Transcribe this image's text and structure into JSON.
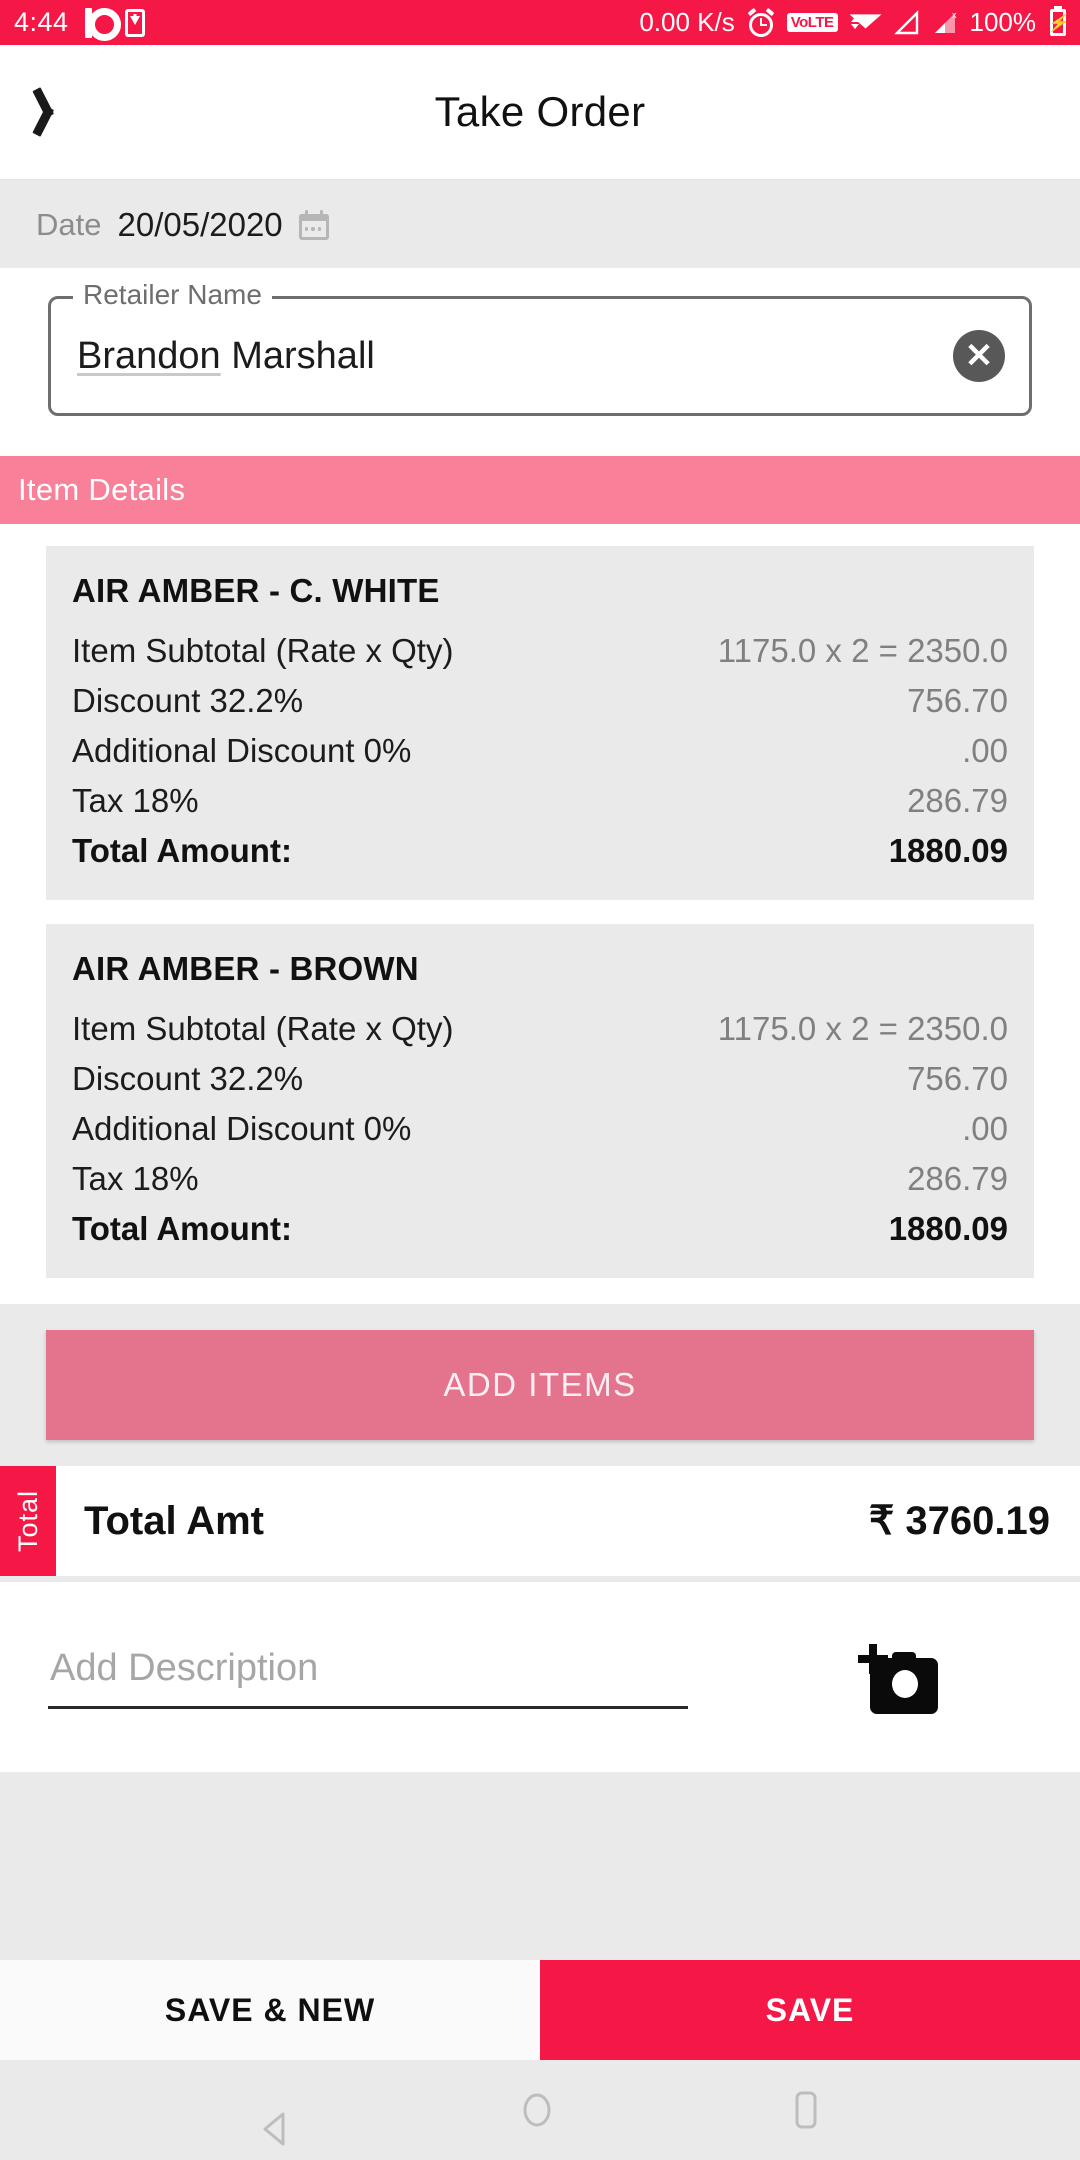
{
  "status_bar": {
    "time": "4:44",
    "network_speed": "0.00 K/s",
    "battery_percent": "100%",
    "volte_label": "VoLTE",
    "icons": [
      "p-logo-icon",
      "phone-download-icon",
      "alarm-icon",
      "volte-icon",
      "wifi-icon",
      "signal-no-sim-icon",
      "signal-bars-icon",
      "battery-charging-icon"
    ]
  },
  "app_bar": {
    "title": "Take Order",
    "back_icon": "chevron-left-icon"
  },
  "date_section": {
    "label": "Date",
    "value": "20/05/2020",
    "icon": "calendar-icon"
  },
  "retailer": {
    "legend": "Retailer Name",
    "value_part1": "Brandon",
    "value_part2": "Marshall",
    "clear_icon": "close-circle-icon"
  },
  "item_details": {
    "section_title": "Item Details",
    "labels": {
      "subtotal": "Item Subtotal (Rate x Qty)",
      "discount": "Discount  32.2%",
      "additional_discount": "Additional Discount 0%",
      "tax": "Tax  18%",
      "total": "Total Amount:"
    },
    "items": [
      {
        "name": "AIR AMBER - C. WHITE",
        "subtotal_label": "Item Subtotal (Rate x Qty)",
        "subtotal_value": "1175.0 x 2 = 2350.0",
        "discount_label": "Discount  32.2%",
        "discount_value": "756.70",
        "additional_discount_label": "Additional Discount 0%",
        "additional_discount_value": ".00",
        "tax_label": "Tax  18%",
        "tax_value": "286.79",
        "total_label": "Total Amount:",
        "total_value": "1880.09"
      },
      {
        "name": "AIR AMBER - BROWN",
        "subtotal_label": "Item Subtotal (Rate x Qty)",
        "subtotal_value": "1175.0 x 2 = 2350.0",
        "discount_label": "Discount  32.2%",
        "discount_value": "756.70",
        "additional_discount_label": "Additional Discount 0%",
        "additional_discount_value": ".00",
        "tax_label": "Tax  18%",
        "tax_value": "286.79",
        "total_label": "Total Amount:",
        "total_value": "1880.09"
      }
    ]
  },
  "add_items_button": {
    "label": "ADD ITEMS"
  },
  "total_bar": {
    "tab_label": "Total",
    "label": "Total Amt",
    "value": "₹ 3760.19"
  },
  "description": {
    "placeholder": "Add Description",
    "value": "",
    "camera_icon": "add-photo-camera-icon"
  },
  "actions": {
    "save_new_label": "SAVE & NEW",
    "save_label": "SAVE"
  },
  "nav_bar": {
    "back_icon": "triangle-back-icon",
    "home_icon": "circle-home-icon",
    "recents_icon": "square-recents-icon"
  },
  "colors": {
    "primary": "#F51847",
    "section_pink": "#F98099",
    "button_pink": "#E4738D",
    "card_gray": "#EAEAEA",
    "page_bg": "#EAEAEA"
  }
}
